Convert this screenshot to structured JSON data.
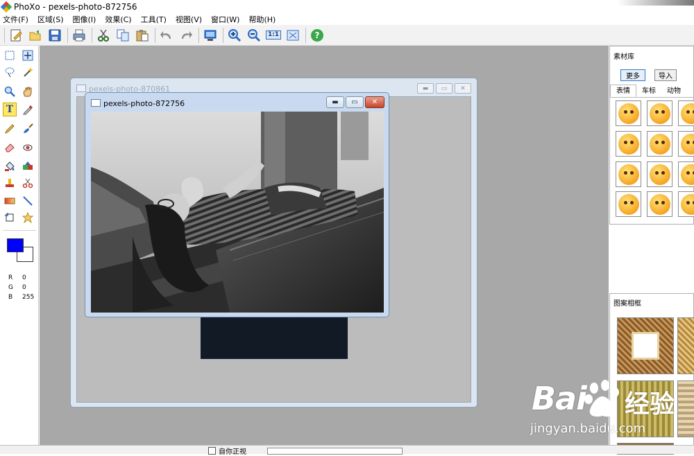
{
  "window": {
    "app_title": "PhoXo - pexels-photo-872756"
  },
  "menu": [
    "文件(F)",
    "区域(S)",
    "图像(I)",
    "效果(C)",
    "工具(T)",
    "视图(V)",
    "窗口(W)",
    "帮助(H)"
  ],
  "toolbar": {
    "icons": [
      "new-icon",
      "open-icon",
      "save-icon",
      "print-icon",
      "cut-icon",
      "copy-icon",
      "paste-icon",
      "undo-icon",
      "redo-icon",
      "screen-capture-icon",
      "zoom-in-icon",
      "zoom-out-icon",
      "actual-size-icon",
      "fit-window-icon",
      "help-icon"
    ],
    "actual_size_label": "1:1",
    "help_label": "?"
  },
  "tools": {
    "items": [
      "select-rect-icon",
      "move-icon",
      "lasso-icon",
      "magic-wand-icon",
      "zoom-tool-icon",
      "hand-icon",
      "text-tool-icon",
      "eyedropper-icon",
      "pencil-icon",
      "brush-icon",
      "eraser-icon",
      "redeye-icon",
      "fill-icon",
      "color-replace-icon",
      "clone-icon",
      "scissors-icon",
      "gradient-icon",
      "line-icon",
      "crop-rotate-icon",
      "star-shape-icon"
    ],
    "text_tool_label": "T"
  },
  "colors": {
    "foreground": "#0000ff",
    "background": "#ffffff"
  },
  "rgb": {
    "r_label": "R",
    "r": "0",
    "g_label": "G",
    "g": "0",
    "b_label": "B",
    "b": "255"
  },
  "documents": [
    {
      "title": "pexels-photo-870861"
    },
    {
      "title": "pexels-photo-872756"
    }
  ],
  "material_panel": {
    "title": "素材库",
    "more_button": "更多",
    "import_button": "导入",
    "tabs": [
      "表情",
      "车标",
      "动物"
    ]
  },
  "frame_panel": {
    "title": "图案相框"
  },
  "statusbar": {
    "checkbox_label": "自你正视"
  },
  "watermark": {
    "brand": "Bai",
    "brand_suffix": "经验",
    "url": "jingyan.baidu.com"
  }
}
